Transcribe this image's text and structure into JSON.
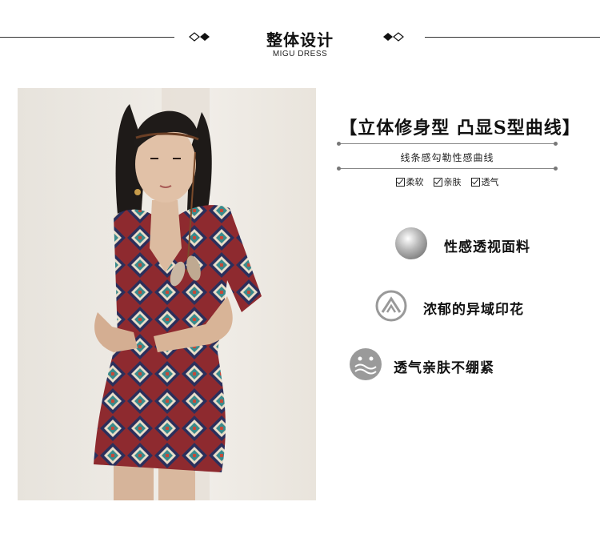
{
  "header": {
    "title": "整体设计",
    "subtitle": "MIGU DRESS"
  },
  "headline": "【立体修身型 凸显S型曲线】",
  "subline": "线条感勾勒性感曲线",
  "checks": [
    {
      "label": "柔软"
    },
    {
      "label": "亲肤"
    },
    {
      "label": "透气"
    }
  ],
  "features": [
    {
      "label": "性感透视面料",
      "icon": "gradient-sphere-icon"
    },
    {
      "label": "浓郁的异域印花",
      "icon": "mountain-circle-icon"
    },
    {
      "label": "透气亲肤不绷紧",
      "icon": "smile-wave-icon"
    }
  ],
  "colors": {
    "accent": "#111111",
    "icon_gray": "#999999",
    "dress_red": "#8e2a2f",
    "dress_teal": "#3a8a8c",
    "dress_navy": "#2b2f5c"
  }
}
